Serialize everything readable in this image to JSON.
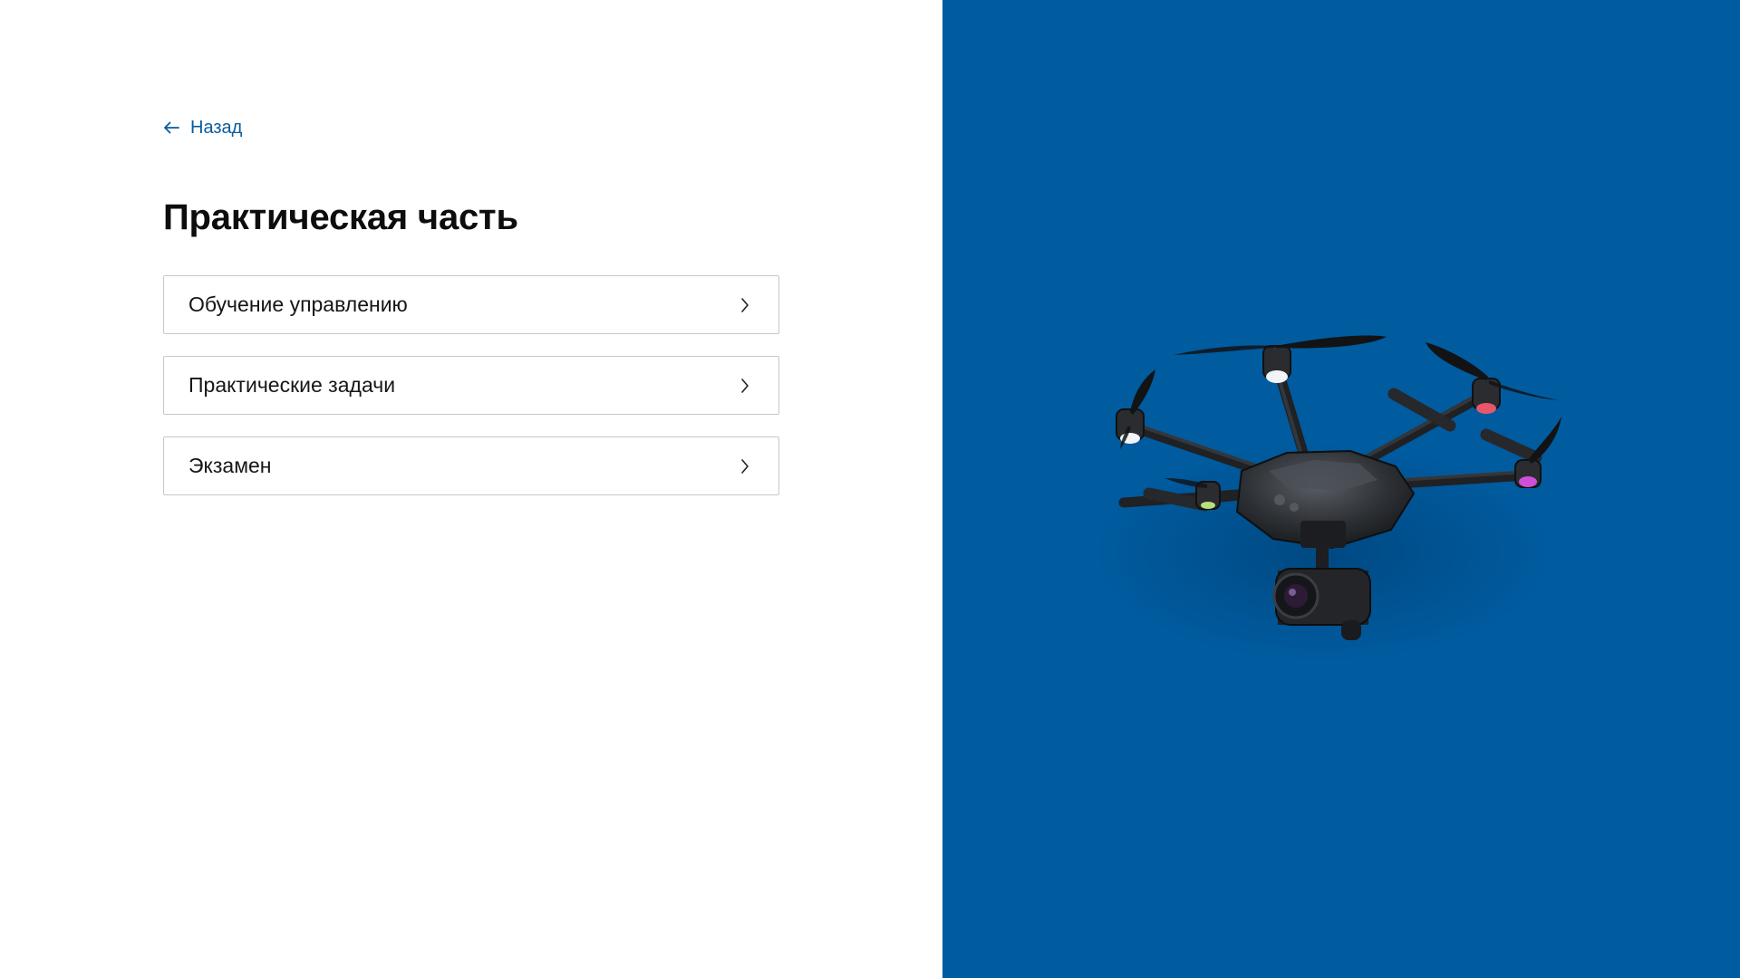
{
  "nav": {
    "back_label": "Назад"
  },
  "page": {
    "title": "Практическая часть"
  },
  "menu": {
    "items": [
      {
        "label": "Обучение управлению"
      },
      {
        "label": "Практические задачи"
      },
      {
        "label": "Экзамен"
      }
    ]
  },
  "icons": {
    "back": "arrow-left-icon",
    "item_chevron": "chevron-right-icon",
    "hero": "drone-illustration"
  },
  "colors": {
    "accent": "#0a5a9e",
    "hero_background": "#005b9f",
    "item_border": "#c8c8c8",
    "title_text": "#0d0d0d"
  }
}
